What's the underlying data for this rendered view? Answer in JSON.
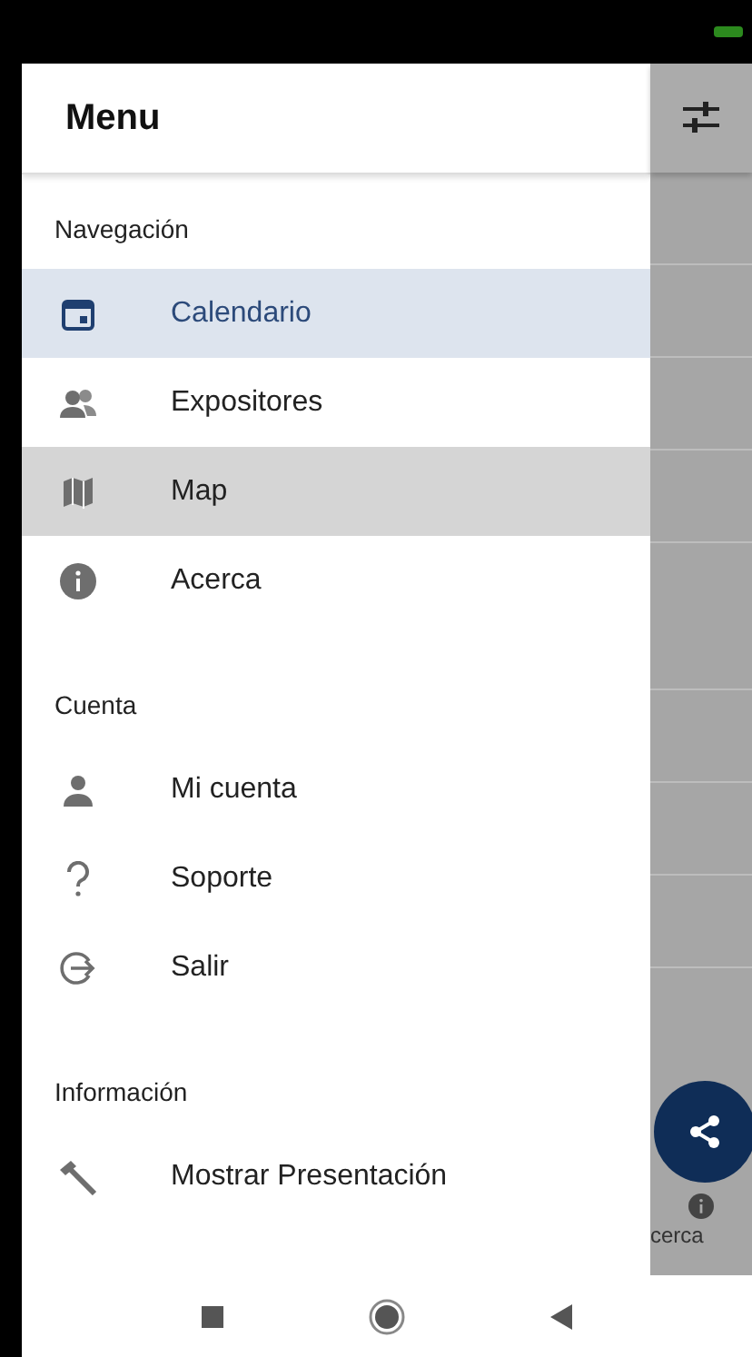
{
  "drawer": {
    "title": "Menu",
    "sections": [
      {
        "label": "Navegación",
        "items": [
          {
            "label": "Calendario",
            "selected": true,
            "pressed": false
          },
          {
            "label": "Expositores",
            "selected": false,
            "pressed": false
          },
          {
            "label": "Map",
            "selected": false,
            "pressed": true
          },
          {
            "label": "Acerca",
            "selected": false,
            "pressed": false
          }
        ]
      },
      {
        "label": "Cuenta",
        "items": [
          {
            "label": "Mi cuenta",
            "selected": false,
            "pressed": false
          },
          {
            "label": "Soporte",
            "selected": false,
            "pressed": false
          },
          {
            "label": "Salir",
            "selected": false,
            "pressed": false
          }
        ]
      },
      {
        "label": "Información",
        "items": [
          {
            "label": "Mostrar Presentación",
            "selected": false,
            "pressed": false
          }
        ]
      }
    ]
  },
  "background": {
    "tab_label": "cerca"
  }
}
